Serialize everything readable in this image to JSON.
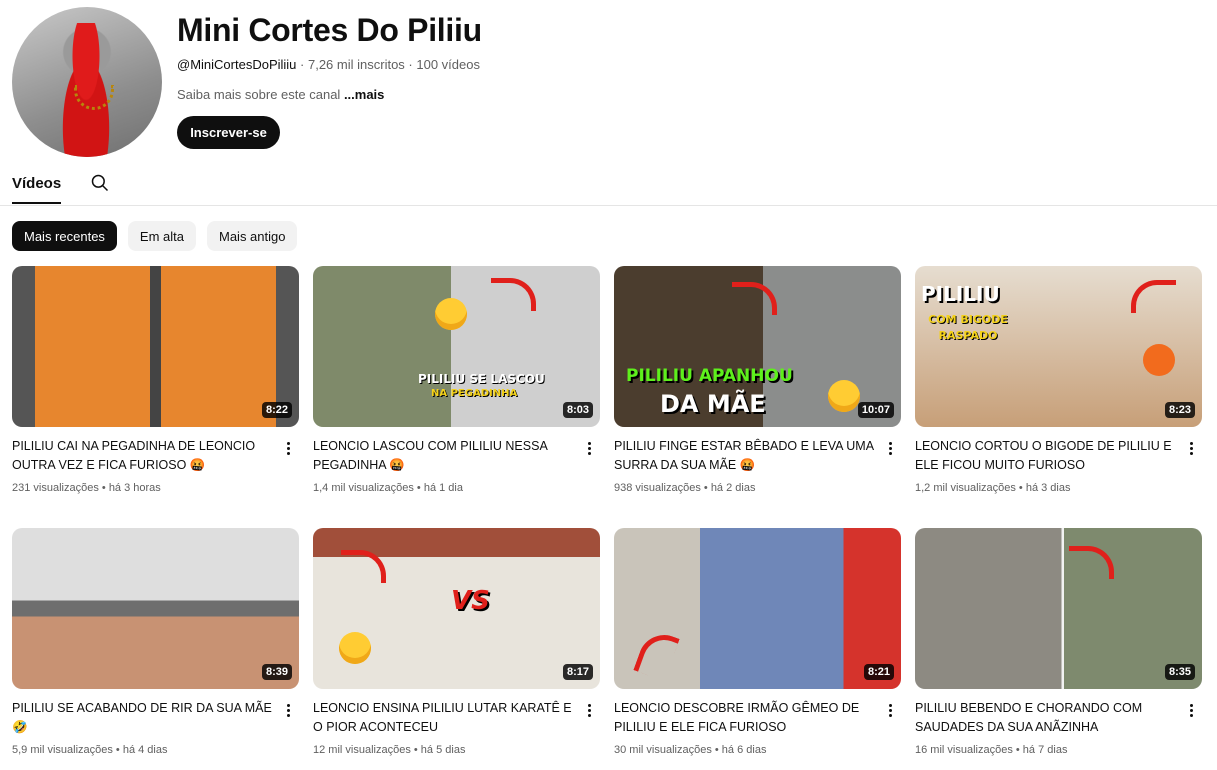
{
  "channel": {
    "name": "Mini Cortes Do Piliiu",
    "handle": "@MiniCortesDoPiliiu",
    "subscribers": "7,26 mil inscritos",
    "video_count": "100 vídeos",
    "about_text": "Saiba mais sobre este canal",
    "about_more": "...mais",
    "subscribe_label": "Inscrever-se",
    "avatar_icon": "channel-avatar"
  },
  "tabs": {
    "videos_label": "Vídeos",
    "search_icon": "search-icon"
  },
  "chips": [
    "Mais recentes",
    "Em alta",
    "Mais antigo"
  ],
  "videos": [
    {
      "title": "PILILIU CAI NA PEGADINHA DE LEONCIO OUTRA VEZ E FICA FURIOSO 🤬",
      "views": "231 visualizações",
      "age": "há 3 horas",
      "duration": "8:22",
      "bg": "#b9b9b9"
    },
    {
      "title": "LEONCIO LASCOU COM PILILIU NESSA PEGADINHA 🤬",
      "views": "1,4 mil visualizações",
      "age": "há 1 dia",
      "duration": "8:03",
      "bg": "#9a8a6f",
      "overlay": "PILILIU SE LASCOU",
      "overlay2": "NA PEGADINHA"
    },
    {
      "title": "PILILIU FINGE ESTAR BÊBADO E LEVA UMA SURRA DA SUA MÃE 🤬",
      "views": "938 visualizações",
      "age": "há 2 dias",
      "duration": "10:07",
      "bg": "#6d6a63",
      "overlay": "PILILIU APANHOU",
      "overlay2": "DA MÃE"
    },
    {
      "title": "LEONCIO CORTOU O BIGODE DE PILILIU E ELE FICOU MUITO FURIOSO",
      "views": "1,2 mil visualizações",
      "age": "há 3 dias",
      "duration": "8:23",
      "bg": "#d8c8b6",
      "overlay": "PILILIU",
      "overlay2": "COM BIGODE RASPADO"
    },
    {
      "title": "PILILIU SE ACABANDO DE RIR DA SUA MÃE 🤣",
      "views": "5,9 mil visualizações",
      "age": "há 4 dias",
      "duration": "8:39",
      "bg": "#d9d9d9"
    },
    {
      "title": "LEONCIO ENSINA PILILIU LUTAR KARATÊ E O PIOR ACONTECEU",
      "views": "12 mil visualizações",
      "age": "há 5 dias",
      "duration": "8:17",
      "bg": "#c7c1b6",
      "overlay": "VS"
    },
    {
      "title": "LEONCIO DESCOBRE IRMÃO GÊMEO DE PILILIU E ELE FICA FURIOSO",
      "views": "30 mil visualizações",
      "age": "há 6 dias",
      "duration": "8:21",
      "bg": "#cfc9c0"
    },
    {
      "title": "PILILIU BEBENDO E CHORANDO COM SAUDADES DA SUA ANÃZINHA",
      "views": "16 mil visualizações",
      "age": "há 7 dias",
      "duration": "8:35",
      "bg": "#a7a39a"
    }
  ]
}
